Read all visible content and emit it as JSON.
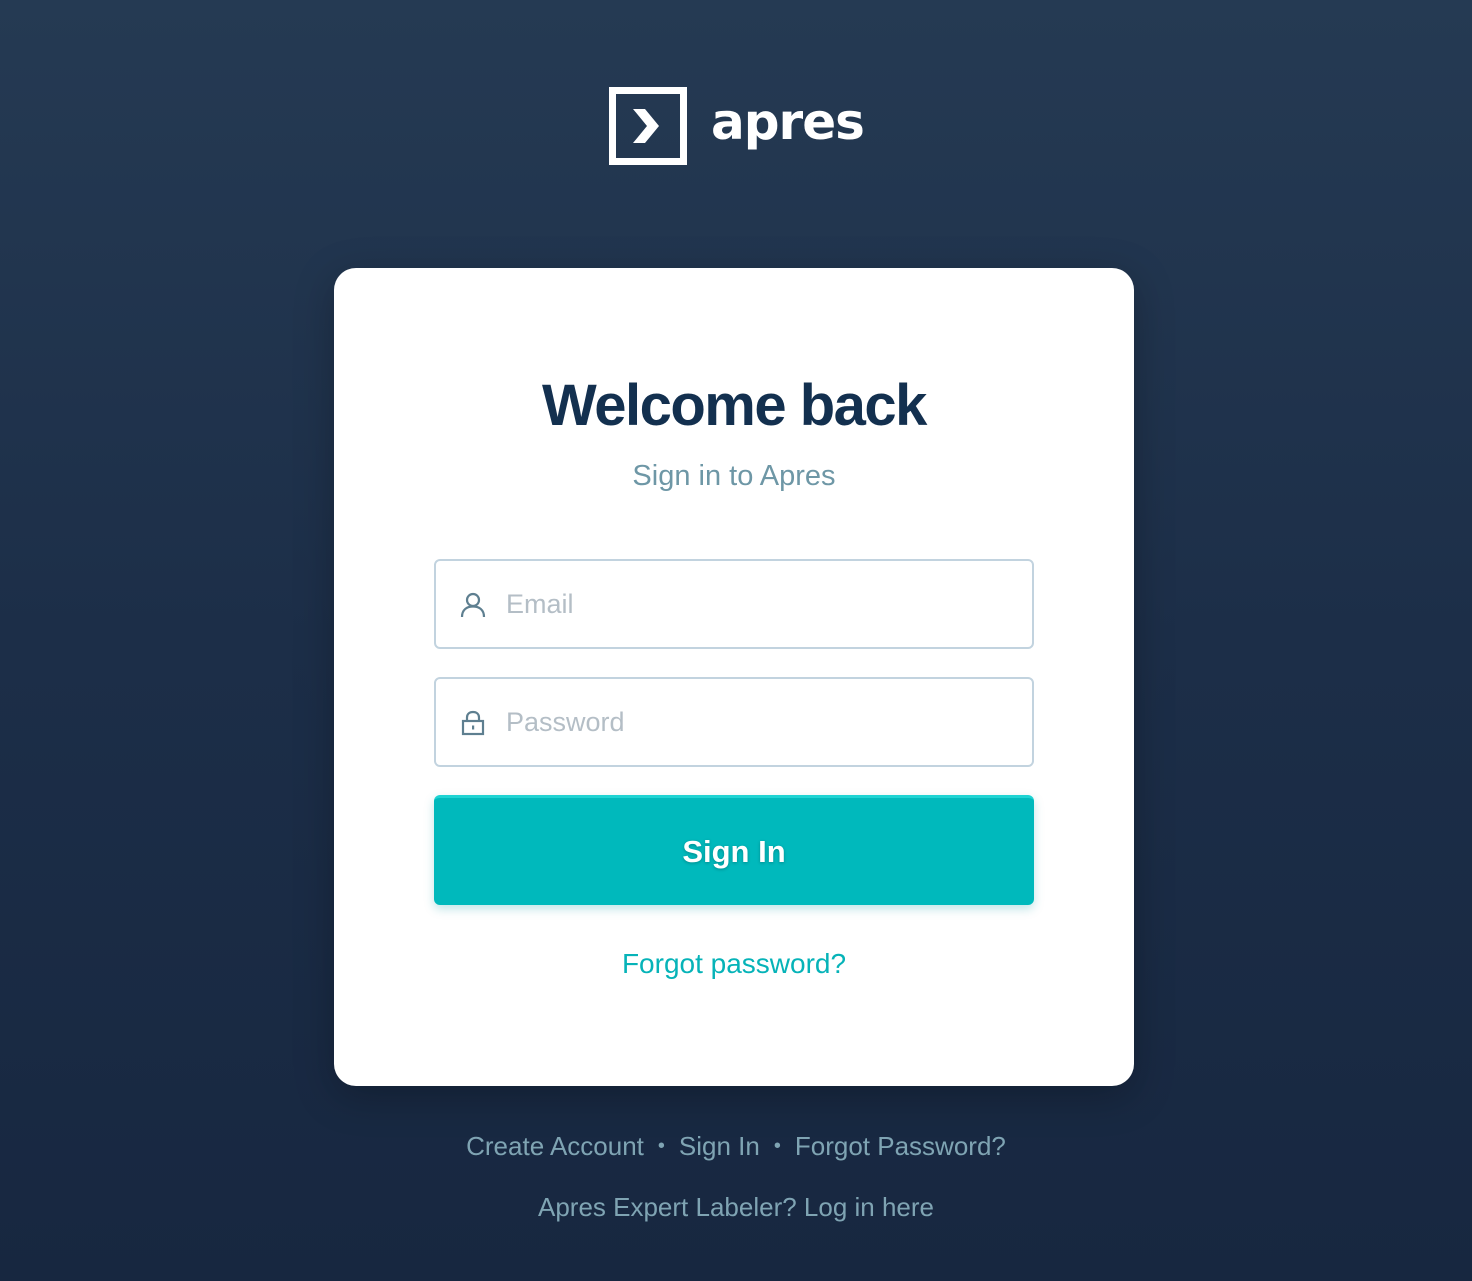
{
  "brand": {
    "name": "apres",
    "logo_icon": "chevron-right-square-icon",
    "color": "#ffffff"
  },
  "card": {
    "title": "Welcome back",
    "subtitle": "Sign in to Apres"
  },
  "form": {
    "email": {
      "placeholder": "Email",
      "value": "",
      "icon": "user-icon"
    },
    "password": {
      "placeholder": "Password",
      "value": "",
      "icon": "lock-icon"
    },
    "submit_label": "Sign In",
    "forgot_label": "Forgot password?"
  },
  "footer": {
    "links": [
      "Create Account",
      "Sign In",
      "Forgot Password?"
    ],
    "separator": "•",
    "expert_link": "Apres Expert Labeler? Log in here"
  },
  "colors": {
    "accent": "#00b9bc",
    "title": "#13304f",
    "subtitle": "#6e97a6",
    "background_top": "#253a53",
    "background_bottom": "#172740",
    "footer_text": "#7fa4b3"
  }
}
